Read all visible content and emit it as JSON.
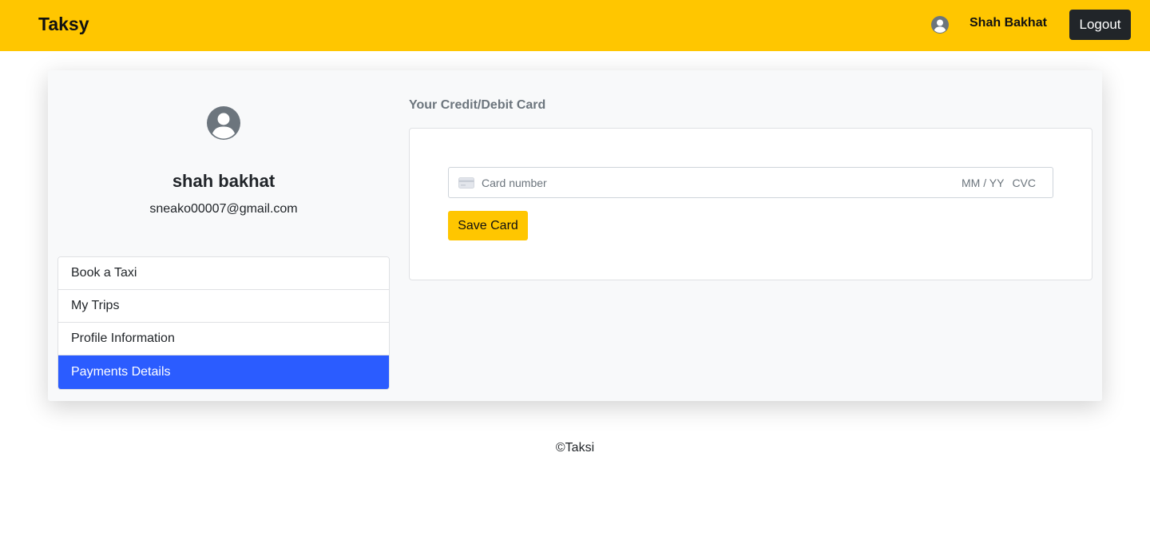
{
  "navbar": {
    "brand": "Taksy",
    "user_name": "Shah Bakhat",
    "logout_label": "Logout"
  },
  "profile": {
    "name": "shah bakhat",
    "email": "sneako00007@gmail.com"
  },
  "menu": {
    "items": [
      {
        "label": "Book a Taxi",
        "active": false
      },
      {
        "label": "My Trips",
        "active": false
      },
      {
        "label": "Profile Information",
        "active": false
      },
      {
        "label": "Payments Details",
        "active": true
      }
    ]
  },
  "payment": {
    "title": "Your Credit/Debit Card",
    "card_placeholder": "Card number",
    "expiry_placeholder": "MM / YY",
    "cvc_placeholder": "CVC",
    "save_label": "Save Card"
  },
  "footer": {
    "text": "©Taksi"
  },
  "colors": {
    "brand_yellow": "#ffc600",
    "active_blue": "#2b5cff",
    "dark_button": "#212529"
  },
  "icons": {
    "nav_avatar": "user-circle-icon",
    "profile_avatar": "user-circle-icon",
    "card": "credit-card-icon"
  }
}
